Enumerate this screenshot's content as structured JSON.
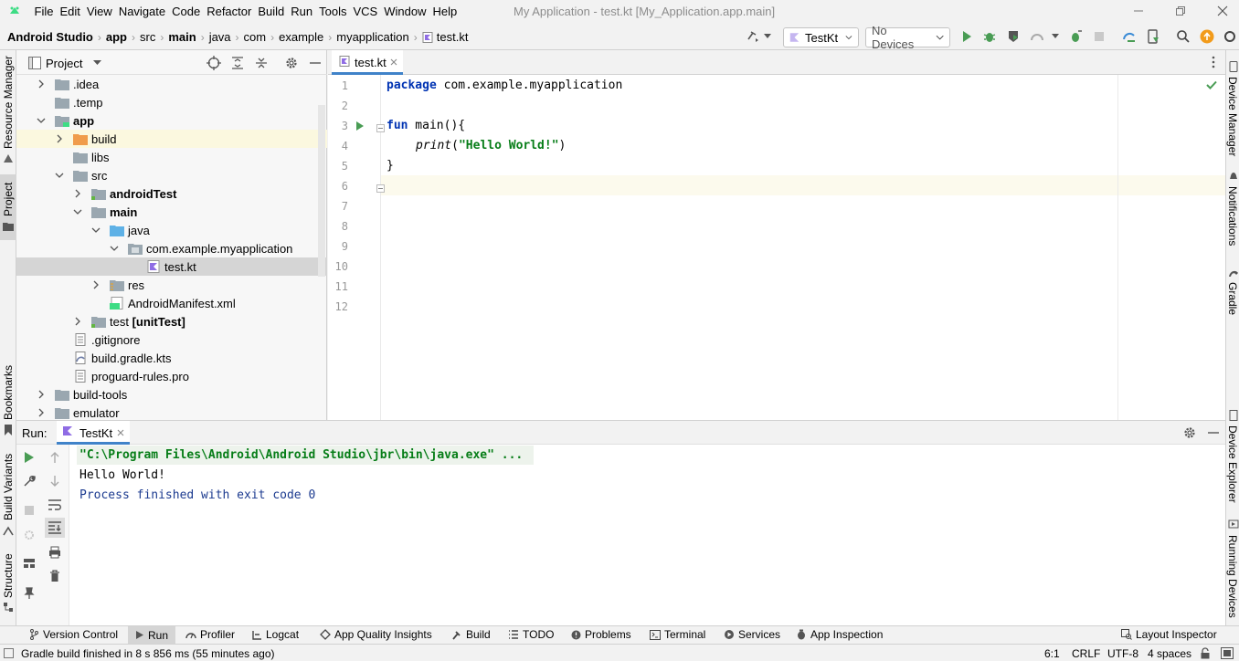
{
  "menubar": {
    "items": [
      "File",
      "Edit",
      "View",
      "Navigate",
      "Code",
      "Refactor",
      "Build",
      "Run",
      "Tools",
      "VCS",
      "Window",
      "Help"
    ],
    "window_title": "My Application - test.kt [My_Application.app.main]"
  },
  "breadcrumbs": [
    "Android Studio",
    "app",
    "src",
    "main",
    "java",
    "com",
    "example",
    "myapplication",
    "test.kt"
  ],
  "toolbar": {
    "run_config": "TestKt",
    "device": "No Devices"
  },
  "left_stripe": {
    "resource_manager": "Resource Manager",
    "project": "Project",
    "bookmarks": "Bookmarks",
    "build_variants": "Build Variants",
    "structure": "Structure"
  },
  "right_stripe": {
    "device_manager": "Device Manager",
    "notifications": "Notifications",
    "gradle": "Gradle",
    "device_explorer": "Device Explorer",
    "running_devices": "Running Devices"
  },
  "project": {
    "title": "Project",
    "tree": [
      {
        "label": ".idea",
        "depth": 1,
        "arrow": "right",
        "icon": "folder",
        "bold": false
      },
      {
        "label": ".temp",
        "depth": 1,
        "arrow": "none",
        "icon": "folder",
        "bold": false
      },
      {
        "label": "app",
        "depth": 1,
        "arrow": "down",
        "icon": "module",
        "bold": true
      },
      {
        "label": "build",
        "depth": 2,
        "arrow": "right",
        "icon": "folder-orange",
        "bold": false
      },
      {
        "label": "libs",
        "depth": 2,
        "arrow": "none",
        "icon": "folder",
        "bold": false
      },
      {
        "label": "src",
        "depth": 2,
        "arrow": "down",
        "icon": "folder",
        "bold": false
      },
      {
        "label": "androidTest",
        "depth": 3,
        "arrow": "right",
        "icon": "folder-test",
        "bold": true
      },
      {
        "label": "main",
        "depth": 3,
        "arrow": "down",
        "icon": "folder",
        "bold": true
      },
      {
        "label": "java",
        "depth": 4,
        "arrow": "down",
        "icon": "folder-blue",
        "bold": false
      },
      {
        "label": "com.example.myapplication",
        "depth": 5,
        "arrow": "down",
        "icon": "package",
        "bold": false
      },
      {
        "label": "test.kt",
        "depth": 6,
        "arrow": "none",
        "icon": "kotlin",
        "bold": false
      },
      {
        "label": "res",
        "depth": 4,
        "arrow": "right",
        "icon": "folder-res",
        "bold": false
      },
      {
        "label": "AndroidManifest.xml",
        "depth": 4,
        "arrow": "none",
        "icon": "manifest",
        "bold": false
      },
      {
        "label": "test",
        "suffix": " [unitTest]",
        "depth": 3,
        "arrow": "right",
        "icon": "folder-test",
        "bold": false
      },
      {
        "label": ".gitignore",
        "depth": 2,
        "arrow": "none",
        "icon": "file",
        "bold": false
      },
      {
        "label": "build.gradle.kts",
        "depth": 2,
        "arrow": "none",
        "icon": "gradle",
        "bold": false
      },
      {
        "label": "proguard-rules.pro",
        "depth": 2,
        "arrow": "none",
        "icon": "file",
        "bold": false
      },
      {
        "label": "build-tools",
        "depth": 1,
        "arrow": "right",
        "icon": "folder",
        "bold": false
      },
      {
        "label": "emulator",
        "depth": 1,
        "arrow": "right",
        "icon": "folder",
        "bold": false
      }
    ]
  },
  "editor": {
    "tab": "test.kt",
    "line_numbers": [
      "1",
      "2",
      "3",
      "4",
      "5",
      "6",
      "7",
      "8",
      "9",
      "10",
      "11",
      "12"
    ],
    "code": {
      "l1_kw": "package",
      "l1_rest": " com.example.myapplication",
      "l3_kw": "fun",
      "l3_rest": " main(){",
      "l4_fn": "print",
      "l4_open": "(",
      "l4_str": "\"Hello World!\"",
      "l4_close": ")",
      "l5": "}"
    }
  },
  "run": {
    "label": "Run:",
    "tab": "TestKt",
    "console": [
      "\"C:\\Program Files\\Android\\Android Studio\\jbr\\bin\\java.exe\" ...",
      "Hello World!",
      "Process finished with exit code 0"
    ]
  },
  "bottom_tools": [
    "Version Control",
    "Run",
    "Profiler",
    "Logcat",
    "App Quality Insights",
    "Build",
    "TODO",
    "Problems",
    "Terminal",
    "Services",
    "App Inspection"
  ],
  "layout_inspector": "Layout Inspector",
  "status": {
    "message": "Gradle build finished in 8 s 856 ms (55 minutes ago)",
    "position": "6:1",
    "line_sep": "CRLF",
    "encoding": "UTF-8",
    "indent": "4 spaces"
  },
  "colors": {
    "accent_green": "#499c54",
    "keyword": "#0033b3",
    "string": "#067d17",
    "caret_line": "#fcfaed",
    "selection": "#d5d5d5",
    "console_info": "#0d6e8a"
  }
}
